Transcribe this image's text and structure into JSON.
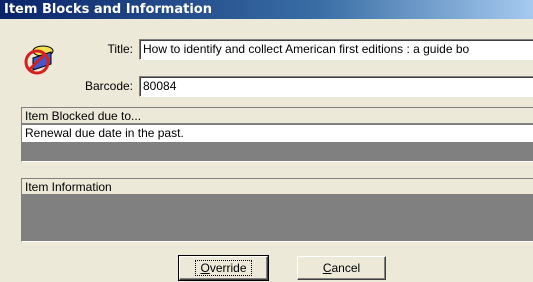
{
  "window": {
    "title": "Item Blocks and Information"
  },
  "form": {
    "title_label": "Title:",
    "title_value": "How to identify and collect American first editions : a guide bo",
    "barcode_label": "Barcode:",
    "barcode_value": "80084"
  },
  "blocked": {
    "header": "Item Blocked due to...",
    "rows": [
      "Renewal due date in the past."
    ]
  },
  "info": {
    "header": "Item Information"
  },
  "buttons": {
    "override_first": "O",
    "override_rest": "verride",
    "cancel_first": "C",
    "cancel_rest": "ancel"
  },
  "icons": {
    "block_icon": "blocked-item-icon"
  }
}
